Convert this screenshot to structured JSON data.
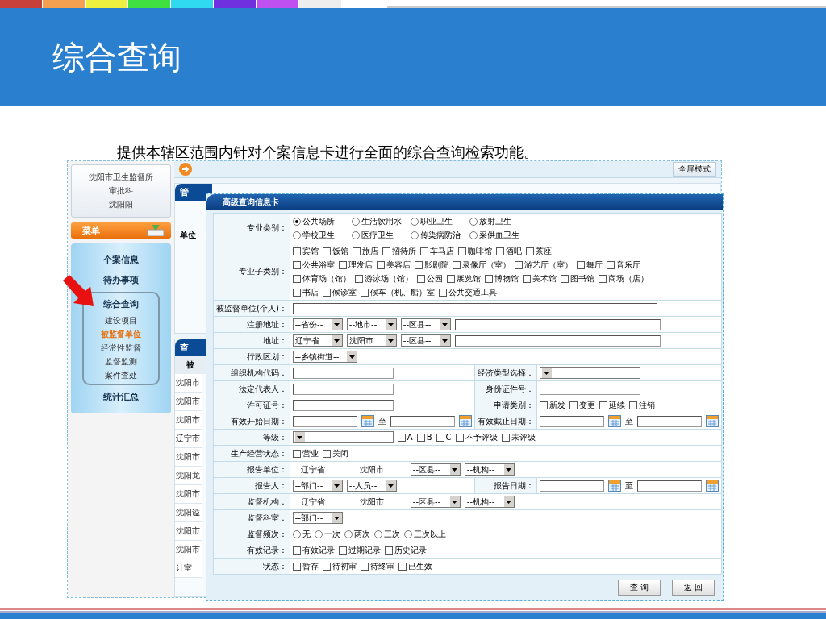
{
  "slide": {
    "title": "综合查询",
    "subtitle": "提供本辖区范围内针对个案信息卡进行全面的综合查询检索功能。"
  },
  "sidebar": {
    "org_lines": [
      "沈阳市卫生监督所",
      "审批科",
      "沈阳阳"
    ],
    "menu_title": "菜单",
    "items": [
      {
        "label": "个案信息",
        "kind": "item"
      },
      {
        "label": "待办事项",
        "kind": "item"
      },
      {
        "label": "综合查询",
        "kind": "group",
        "expanded": true,
        "children": [
          {
            "label": "建设项目",
            "selected": false
          },
          {
            "label": "被监督单位",
            "selected": true
          },
          {
            "label": "经常性监督",
            "selected": false
          },
          {
            "label": "监督监测",
            "selected": false
          },
          {
            "label": "案件查处",
            "selected": false
          }
        ]
      },
      {
        "label": "统计汇总",
        "kind": "item"
      }
    ]
  },
  "toolbar": {
    "button": "全屏模式"
  },
  "panels": [
    {
      "tab": "管",
      "lines": [
        "单位"
      ]
    },
    {
      "tab": "查",
      "header": "被",
      "lines": [
        "沈阳市",
        "沈阳市",
        "沈阳市",
        "辽宁市",
        "沈阳市",
        "沈阳龙",
        "沈阳市",
        "沈阳谥",
        "沈阳市",
        "沈阳市",
        "计室"
      ]
    }
  ],
  "dialog": {
    "title": "高级查询信息卡",
    "rows": [
      {
        "cells": [
          {
            "label": "专业类别：",
            "lines": [
              [
                {
                  "kind": "radio",
                  "label": "公共场所",
                  "selected": true
                },
                {
                  "kind": "radio",
                  "label": "生活饮用水",
                  "selected": false
                },
                {
                  "kind": "radio",
                  "label": "职业卫生",
                  "selected": false
                },
                {
                  "kind": "radio",
                  "label": "放射卫生",
                  "selected": false
                }
              ],
              [
                {
                  "kind": "radio",
                  "label": "学校卫生",
                  "selected": false
                },
                {
                  "kind": "radio",
                  "label": "医疗卫生",
                  "selected": false
                },
                {
                  "kind": "radio",
                  "label": "传染病防治",
                  "selected": false
                },
                {
                  "kind": "radio",
                  "label": "采供血卫生",
                  "selected": false
                }
              ]
            ]
          }
        ]
      },
      {
        "cells": [
          {
            "label": "专业子类别：",
            "lines": [
              [
                {
                  "kind": "checkbox",
                  "label": "宾馆",
                  "checked": false
                },
                {
                  "kind": "checkbox",
                  "label": "饭馆",
                  "checked": false
                },
                {
                  "kind": "checkbox",
                  "label": "旅店",
                  "checked": false
                },
                {
                  "kind": "checkbox",
                  "label": "招待所",
                  "checked": false
                },
                {
                  "kind": "checkbox",
                  "label": "车马店",
                  "checked": false
                },
                {
                  "kind": "checkbox",
                  "label": "咖啡馆",
                  "checked": false
                },
                {
                  "kind": "checkbox",
                  "label": "酒吧",
                  "checked": false
                },
                {
                  "kind": "checkbox",
                  "label": "茶座",
                  "checked": false
                }
              ],
              [
                {
                  "kind": "checkbox",
                  "label": "公共浴室",
                  "checked": false
                },
                {
                  "kind": "checkbox",
                  "label": "理发店",
                  "checked": false
                },
                {
                  "kind": "checkbox",
                  "label": "美容店",
                  "checked": false
                },
                {
                  "kind": "checkbox",
                  "label": "影剧院",
                  "checked": false
                },
                {
                  "kind": "checkbox",
                  "label": "录像厅（室）",
                  "checked": false
                },
                {
                  "kind": "checkbox",
                  "label": "游艺厅（室）",
                  "checked": false
                },
                {
                  "kind": "checkbox",
                  "label": "舞厅",
                  "checked": false
                },
                {
                  "kind": "checkbox",
                  "label": "音乐厅",
                  "checked": false
                }
              ],
              [
                {
                  "kind": "checkbox",
                  "label": "体育场（馆）",
                  "checked": false
                },
                {
                  "kind": "checkbox",
                  "label": "游泳场（馆）",
                  "checked": false
                },
                {
                  "kind": "checkbox",
                  "label": "公园",
                  "checked": false
                },
                {
                  "kind": "checkbox",
                  "label": "展览馆",
                  "checked": false
                },
                {
                  "kind": "checkbox",
                  "label": "博物馆",
                  "checked": false
                },
                {
                  "kind": "checkbox",
                  "label": "美术馆",
                  "checked": false
                },
                {
                  "kind": "checkbox",
                  "label": "图书馆",
                  "checked": false
                },
                {
                  "kind": "checkbox",
                  "label": "商场（店）",
                  "checked": false
                }
              ],
              [
                {
                  "kind": "checkbox",
                  "label": "书店",
                  "checked": false
                },
                {
                  "kind": "checkbox",
                  "label": "候诊室",
                  "checked": false
                },
                {
                  "kind": "checkbox",
                  "label": "候车（机、船）室",
                  "checked": false
                },
                {
                  "kind": "checkbox",
                  "label": "公共交通工具",
                  "checked": false
                }
              ]
            ]
          }
        ]
      },
      {
        "cells": [
          {
            "label": "被监督单位(个人)：",
            "lines": [
              [
                {
                  "kind": "text"
                }
              ]
            ]
          }
        ]
      },
      {
        "cells": [
          {
            "label": "注册地址：",
            "lines": [
              [
                {
                  "kind": "select",
                  "value": "--省份--"
                },
                {
                  "kind": "select",
                  "value": "--地市--"
                },
                {
                  "kind": "select",
                  "value": "--区县--"
                },
                {
                  "kind": "text"
                }
              ]
            ]
          }
        ]
      },
      {
        "cells": [
          {
            "label": "地址：",
            "lines": [
              [
                {
                  "kind": "select",
                  "value": "辽宁省"
                },
                {
                  "kind": "select",
                  "value": "沈阳市"
                },
                {
                  "kind": "select",
                  "value": "--区县--"
                },
                {
                  "kind": "text"
                }
              ]
            ]
          }
        ]
      },
      {
        "cells": [
          {
            "label": "行政区划：",
            "lines": [
              [
                {
                  "kind": "select",
                  "value": "--乡镇街道--"
                }
              ]
            ]
          }
        ]
      },
      {
        "cells": [
          {
            "label": "组织机构代码：",
            "lines": [
              [
                {
                  "kind": "text"
                }
              ]
            ]
          },
          {
            "label": "经济类型选择：",
            "lines": [
              [
                {
                  "kind": "select"
                }
              ]
            ]
          }
        ]
      },
      {
        "cells": [
          {
            "label": "法定代表人：",
            "lines": [
              [
                {
                  "kind": "text"
                }
              ]
            ]
          },
          {
            "label": "身份证件号：",
            "lines": [
              [
                {
                  "kind": "text"
                }
              ]
            ]
          }
        ]
      },
      {
        "cells": [
          {
            "label": "许可证号：",
            "lines": [
              [
                {
                  "kind": "text"
                }
              ]
            ]
          },
          {
            "label": "申请类别：",
            "lines": [
              [
                {
                  "kind": "checkbox",
                  "label": "新发",
                  "checked": false
                },
                {
                  "kind": "checkbox",
                  "label": "变更",
                  "checked": false
                },
                {
                  "kind": "checkbox",
                  "label": "延续",
                  "checked": false
                },
                {
                  "kind": "checkbox",
                  "label": "注销",
                  "checked": false
                }
              ]
            ]
          }
        ]
      },
      {
        "cells": [
          {
            "label": "有效开始日期：",
            "lines": [
              [
                {
                  "kind": "text"
                },
                {
                  "kind": "calendar"
                },
                {
                  "kind": "sep",
                  "text": "至"
                },
                {
                  "kind": "text"
                },
                {
                  "kind": "calendar"
                }
              ]
            ]
          },
          {
            "label": "有效截止日期：",
            "lines": [
              [
                {
                  "kind": "text"
                },
                {
                  "kind": "calendar"
                },
                {
                  "kind": "sep",
                  "text": "至"
                },
                {
                  "kind": "text"
                },
                {
                  "kind": "calendar"
                }
              ]
            ]
          }
        ]
      },
      {
        "cells": [
          {
            "label": "等级：",
            "lines": [
              [
                {
                  "kind": "select"
                },
                {
                  "kind": "checkbox",
                  "label": "A",
                  "checked": false
                },
                {
                  "kind": "checkbox",
                  "label": "B",
                  "checked": false
                },
                {
                  "kind": "checkbox",
                  "label": "C",
                  "checked": false
                },
                {
                  "kind": "checkbox",
                  "label": "不予评级",
                  "checked": false
                },
                {
                  "kind": "checkbox",
                  "label": "未评级",
                  "checked": false
                }
              ]
            ]
          }
        ]
      },
      {
        "cells": [
          {
            "label": "生产经营状态：",
            "lines": [
              [
                {
                  "kind": "checkbox",
                  "label": "营业",
                  "checked": false
                },
                {
                  "kind": "checkbox",
                  "label": "关闭",
                  "checked": false
                }
              ]
            ]
          }
        ]
      },
      {
        "cells": [
          {
            "label": "报告单位：",
            "lines": [
              [
                {
                  "kind": "static",
                  "text": "辽宁省"
                },
                {
                  "kind": "static",
                  "text": "沈阳市"
                },
                {
                  "kind": "select",
                  "value": "--区县--"
                },
                {
                  "kind": "select",
                  "value": "--机构--"
                }
              ]
            ]
          }
        ]
      },
      {
        "cells": [
          {
            "label": "报告人：",
            "lines": [
              [
                {
                  "kind": "select",
                  "value": "--部门--"
                },
                {
                  "kind": "select",
                  "value": "--人员--"
                }
              ]
            ]
          },
          {
            "label": "报告日期：",
            "lines": [
              [
                {
                  "kind": "text"
                },
                {
                  "kind": "calendar"
                },
                {
                  "kind": "sep",
                  "text": "至"
                },
                {
                  "kind": "text"
                },
                {
                  "kind": "calendar"
                }
              ]
            ]
          }
        ]
      },
      {
        "cells": [
          {
            "label": "监督机构：",
            "lines": [
              [
                {
                  "kind": "static",
                  "text": "辽宁省"
                },
                {
                  "kind": "static",
                  "text": "沈阳市"
                },
                {
                  "kind": "select",
                  "value": "--区县--"
                },
                {
                  "kind": "select",
                  "value": "--机构--"
                }
              ]
            ]
          }
        ]
      },
      {
        "cells": [
          {
            "label": "监督科室：",
            "lines": [
              [
                {
                  "kind": "select",
                  "value": "--部门--"
                }
              ]
            ]
          }
        ]
      },
      {
        "cells": [
          {
            "label": "监督频次：",
            "lines": [
              [
                {
                  "kind": "radio",
                  "label": "无",
                  "selected": false
                },
                {
                  "kind": "radio",
                  "label": "一次",
                  "selected": false
                },
                {
                  "kind": "radio",
                  "label": "两次",
                  "selected": false
                },
                {
                  "kind": "radio",
                  "label": "三次",
                  "selected": false
                },
                {
                  "kind": "radio",
                  "label": "三次以上",
                  "selected": false
                }
              ]
            ]
          }
        ]
      },
      {
        "cells": [
          {
            "label": "有效记录：",
            "lines": [
              [
                {
                  "kind": "checkbox",
                  "label": "有效记录",
                  "checked": false
                },
                {
                  "kind": "checkbox",
                  "label": "过期记录",
                  "checked": false
                },
                {
                  "kind": "checkbox",
                  "label": "历史记录",
                  "checked": false
                }
              ]
            ]
          }
        ]
      },
      {
        "cells": [
          {
            "label": "状态：",
            "lines": [
              [
                {
                  "kind": "checkbox",
                  "label": "暂存",
                  "checked": false
                },
                {
                  "kind": "checkbox",
                  "label": "待初审",
                  "checked": false
                },
                {
                  "kind": "checkbox",
                  "label": "待终审",
                  "checked": false
                },
                {
                  "kind": "checkbox",
                  "label": "已生效",
                  "checked": false
                }
              ]
            ]
          }
        ]
      }
    ],
    "buttons": [
      "查 询",
      "返 回"
    ]
  }
}
